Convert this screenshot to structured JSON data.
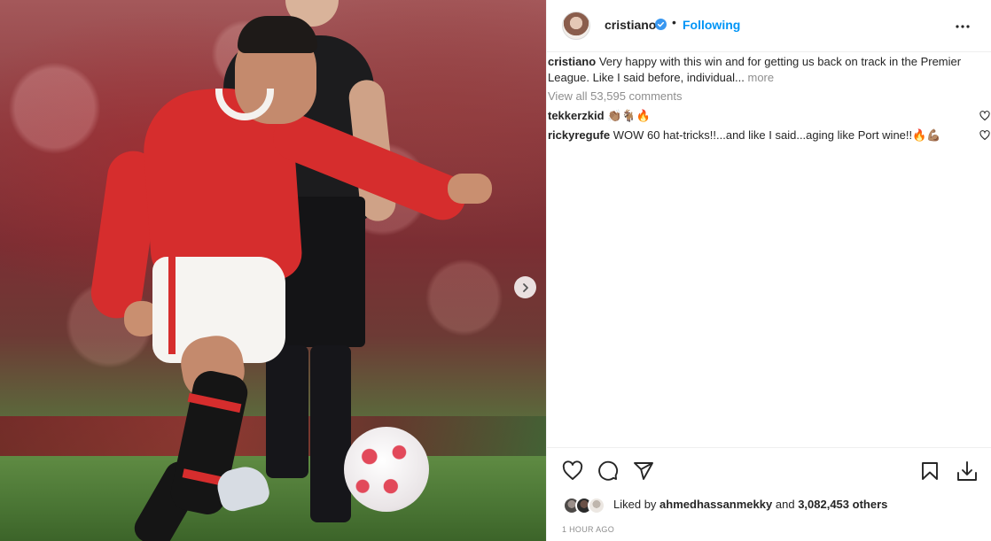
{
  "post": {
    "username": "cristiano",
    "follow_status": "Following",
    "separator": "•",
    "caption_user": "cristiano",
    "caption_text": "Very happy with this win and for getting us back on track in the Premier League. Like I said before, individual...",
    "caption_more": "more",
    "view_all_comments": "View all 53,595 comments",
    "comments": [
      {
        "user": "tekkerzkid",
        "text": "👏🏽🐐🔥"
      },
      {
        "user": "rickyregufe",
        "text": "WOW 60 hat-tricks!!...and like I said...aging like Port wine!!🔥💪🏽"
      }
    ],
    "likes_prefix": "Liked by",
    "liked_by_user": "ahmedhassanmekky",
    "likes_and": "and",
    "likes_others": "3,082,453 others",
    "timestamp": "1 HOUR AGO"
  },
  "colors": {
    "accent": "#0095f6",
    "verified": "#3897f0",
    "muted": "#8e8e8e",
    "text": "#262626"
  },
  "icons": [
    "chevron-right-icon",
    "verified-badge-icon",
    "more-options-icon",
    "heart-icon",
    "comment-icon",
    "share-icon",
    "bookmark-icon",
    "download-icon"
  ]
}
